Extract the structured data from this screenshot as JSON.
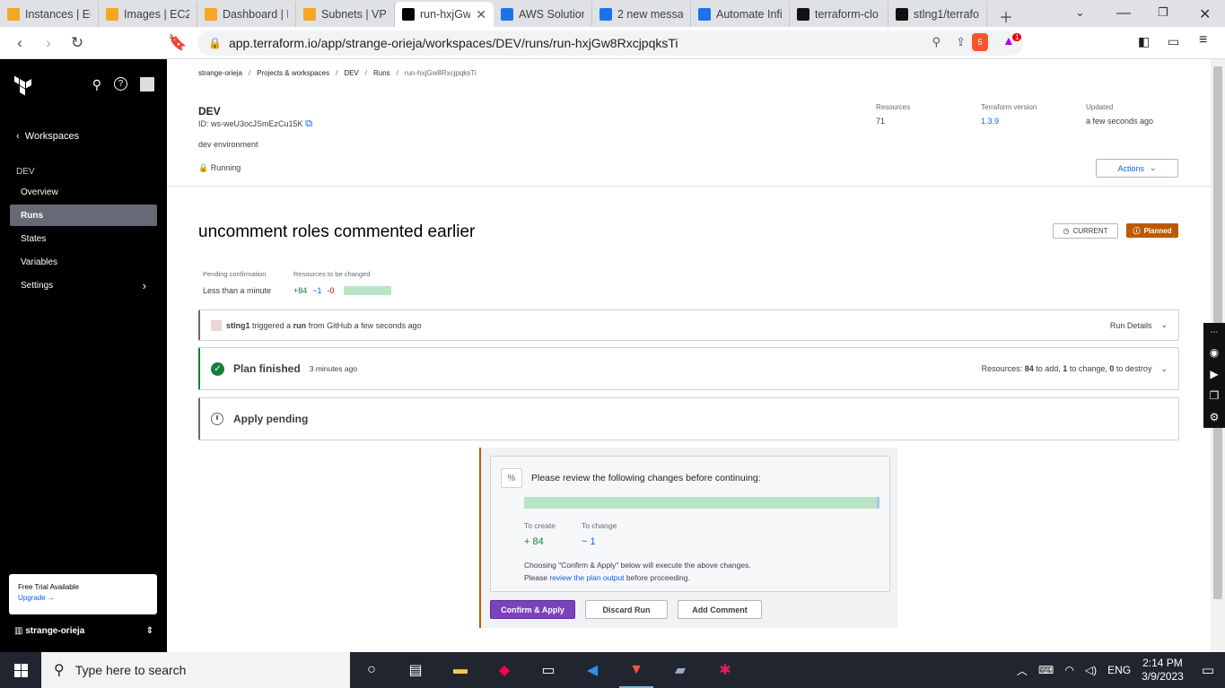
{
  "browser": {
    "tabs": [
      {
        "title": "Instances | EC",
        "fav": "aws-icon",
        "color": "#f5a623"
      },
      {
        "title": "Images | EC2",
        "fav": "aws-icon",
        "color": "#f5a623"
      },
      {
        "title": "Dashboard | E",
        "fav": "aws-icon",
        "color": "#f5a623"
      },
      {
        "title": "Subnets | VPC",
        "fav": "aws-icon",
        "color": "#f5a623"
      },
      {
        "title": "run-hxjGw",
        "fav": "terraform-icon",
        "color": "#000000",
        "active": true
      },
      {
        "title": "AWS Solution",
        "fav": "gmail-icon",
        "color": "#1a73e8"
      },
      {
        "title": "2 new messag",
        "fav": "gmail-icon",
        "color": "#1a73e8"
      },
      {
        "title": "Automate Infi",
        "fav": "gmail-icon",
        "color": "#1a73e8"
      },
      {
        "title": "terraform-clo",
        "fav": "github-icon",
        "color": "#111111"
      },
      {
        "title": "stlng1/terrafo",
        "fav": "github-icon",
        "color": "#111111"
      }
    ],
    "url": "app.terraform.io/app/strange-orieja/workspaces/DEV/runs/run-hxjGw8RxcjpqksTi",
    "brave_badge": "5",
    "rewards_badge": "1"
  },
  "sidebar": {
    "back_label": "Workspaces",
    "section": "DEV",
    "items": [
      {
        "label": "Overview"
      },
      {
        "label": "Runs",
        "active": true
      },
      {
        "label": "States"
      },
      {
        "label": "Variables"
      },
      {
        "label": "Settings",
        "has_chevron": true
      }
    ],
    "trial_title": "Free Trial Available",
    "trial_link": "Upgrade",
    "org": "strange-orieja"
  },
  "breadcrumb": [
    "strange-orieja",
    "Projects & workspaces",
    "DEV",
    "Runs",
    "run-hxjGw8RxcjpqksTi"
  ],
  "workspace": {
    "name": "DEV",
    "id": "ID: ws-weU3ocJSmEzCu15K",
    "description": "dev environment",
    "status": "Running",
    "resources_label": "Resources",
    "resources_value": "71",
    "tf_version_label": "Terraform version",
    "tf_version_value": "1.3.9",
    "updated_label": "Updated",
    "updated_value": "a few seconds ago",
    "actions_label": "Actions"
  },
  "run": {
    "title": "uncomment roles commented earlier",
    "current_badge": "CURRENT",
    "planned_badge": "Planned",
    "pending_label": "Pending confirmation",
    "pending_value": "Less than a minute",
    "resources_changed_label": "Resources to be changed",
    "add": "+84",
    "change": "~1",
    "destroy": "-0",
    "trigger": {
      "user": "stlng1",
      "pre": "triggered a",
      "run": "run",
      "post": "from GitHub a few seconds ago",
      "details": "Run Details"
    },
    "plan": {
      "title": "Plan finished",
      "time": "3 minutes ago",
      "res_prefix": "Resources:",
      "add_n": "84",
      "add_t": "to add,",
      "chg_n": "1",
      "chg_t": "to change,",
      "del_n": "0",
      "del_t": "to destroy"
    },
    "apply_title": "Apply pending"
  },
  "apply_panel": {
    "question": "Please review the following changes before continuing:",
    "to_create_label": "To create",
    "to_create_value": "+ 84",
    "to_change_label": "To change",
    "to_change_value": "~ 1",
    "note_line1": "Choosing \"Confirm & Apply\" below will execute the above changes.",
    "note_pre": "Please",
    "note_link": "review the plan output",
    "note_post": "before proceeding.",
    "confirm_button": "Confirm & Apply",
    "discard_button": "Discard Run",
    "comment_button": "Add Comment"
  },
  "taskbar": {
    "search_placeholder": "Type here to search",
    "lang": "ENG",
    "time": "2:14 PM",
    "date": "3/9/2023"
  }
}
